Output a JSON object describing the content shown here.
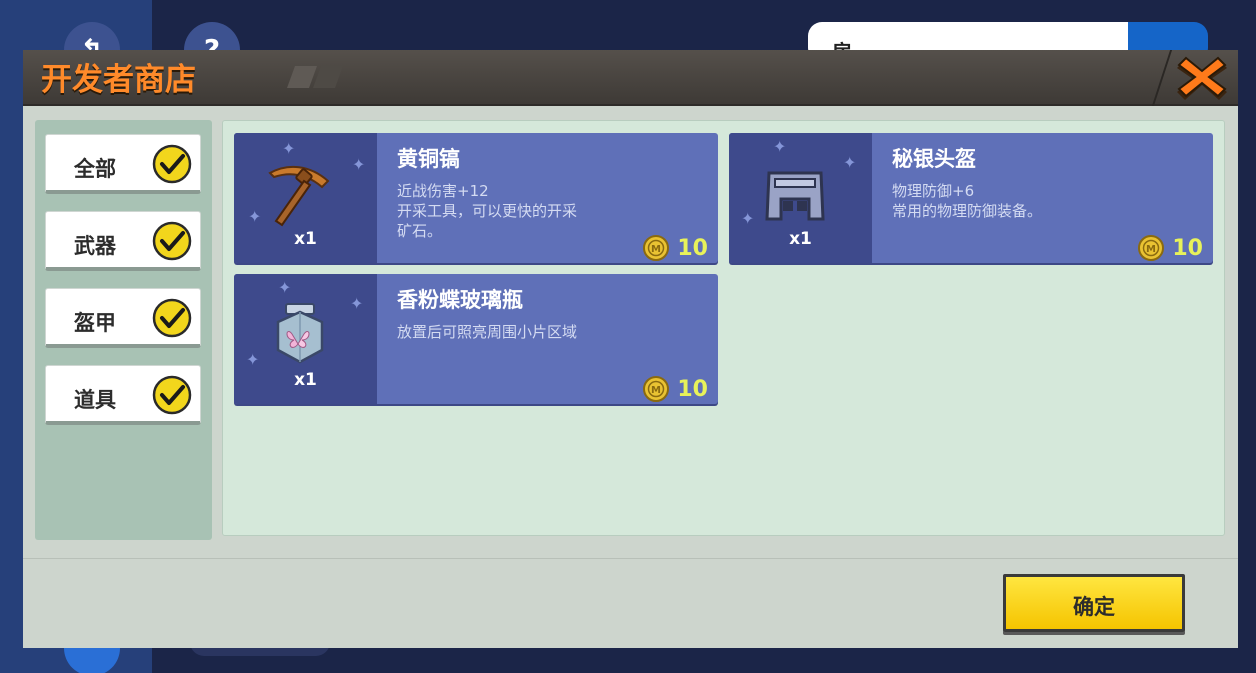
{
  "background": {
    "circle_one_glyph": "↰",
    "circle_two_glyph": "?",
    "search_text": "房"
  },
  "dialog": {
    "title": "开发者商店",
    "close_icon": "close-x-icon"
  },
  "sidebar": {
    "items": [
      {
        "label": "全部",
        "checked": true
      },
      {
        "label": "武器",
        "checked": true
      },
      {
        "label": "盔甲",
        "checked": true
      },
      {
        "label": "道具",
        "checked": true
      }
    ]
  },
  "shop": {
    "items": [
      {
        "name": "黄铜镐",
        "qty": "x1",
        "desc_lines": [
          "近战伤害+12",
          "开采工具，可以更快的开采",
          "矿石。"
        ],
        "price": "10",
        "icon": "pickaxe-icon"
      },
      {
        "name": "秘银头盔",
        "qty": "x1",
        "desc_lines": [
          "物理防御+6",
          "常用的物理防御装备。"
        ],
        "price": "10",
        "icon": "helmet-icon"
      },
      {
        "name": "香粉蝶玻璃瓶",
        "qty": "x1",
        "desc_lines": [
          "放置后可照亮周围小片区域"
        ],
        "price": "10",
        "icon": "butterfly-jar-icon"
      }
    ]
  },
  "footer": {
    "confirm_label": "确定"
  },
  "colors": {
    "title_orange": "#ff8a2a",
    "card_blue": "#5f70b8",
    "price_yellow": "#e8f25a",
    "confirm_yellow": "#ffe640",
    "check_yellow": "#f2d61c"
  }
}
